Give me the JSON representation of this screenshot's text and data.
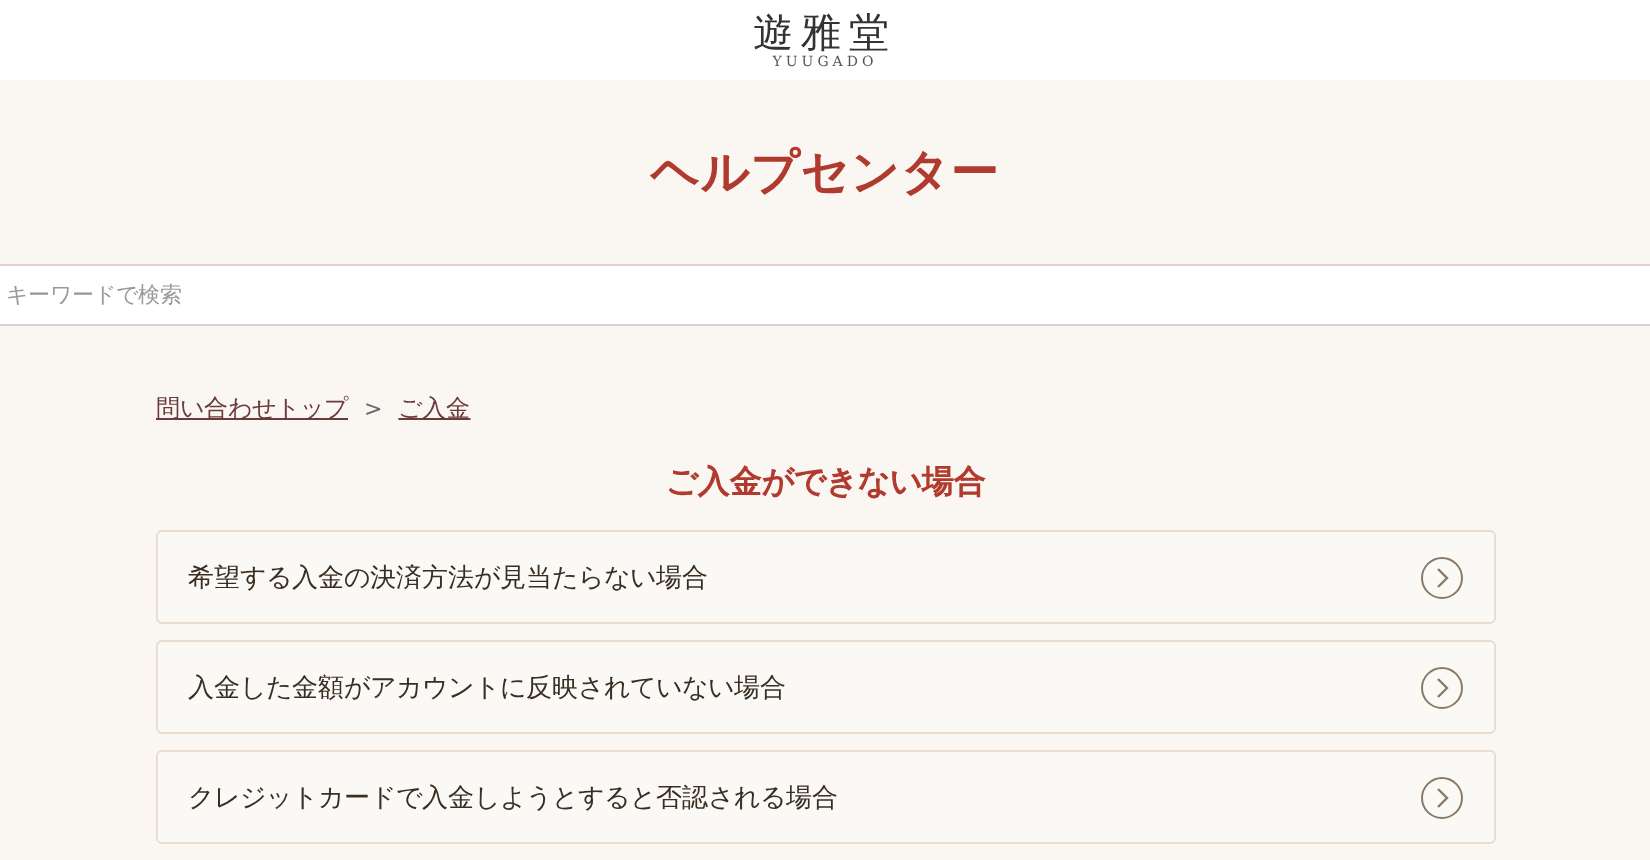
{
  "header": {
    "logo": "遊雅堂",
    "logo_sub": "YUUGADO"
  },
  "title": "ヘルプセンター",
  "search": {
    "placeholder": "キーワードで検索"
  },
  "breadcrumb": [
    {
      "label": "問い合わせトップ"
    },
    {
      "label": "ご入金"
    }
  ],
  "breadcrumb_separator": ">",
  "section_title": "ご入金ができない場合",
  "items": [
    {
      "label": "希望する入金の決済方法が見当たらない場合"
    },
    {
      "label": "入金した金額がアカウントに反映されていない場合"
    },
    {
      "label": "クレジットカードで入金しようとすると否認される場合"
    }
  ]
}
